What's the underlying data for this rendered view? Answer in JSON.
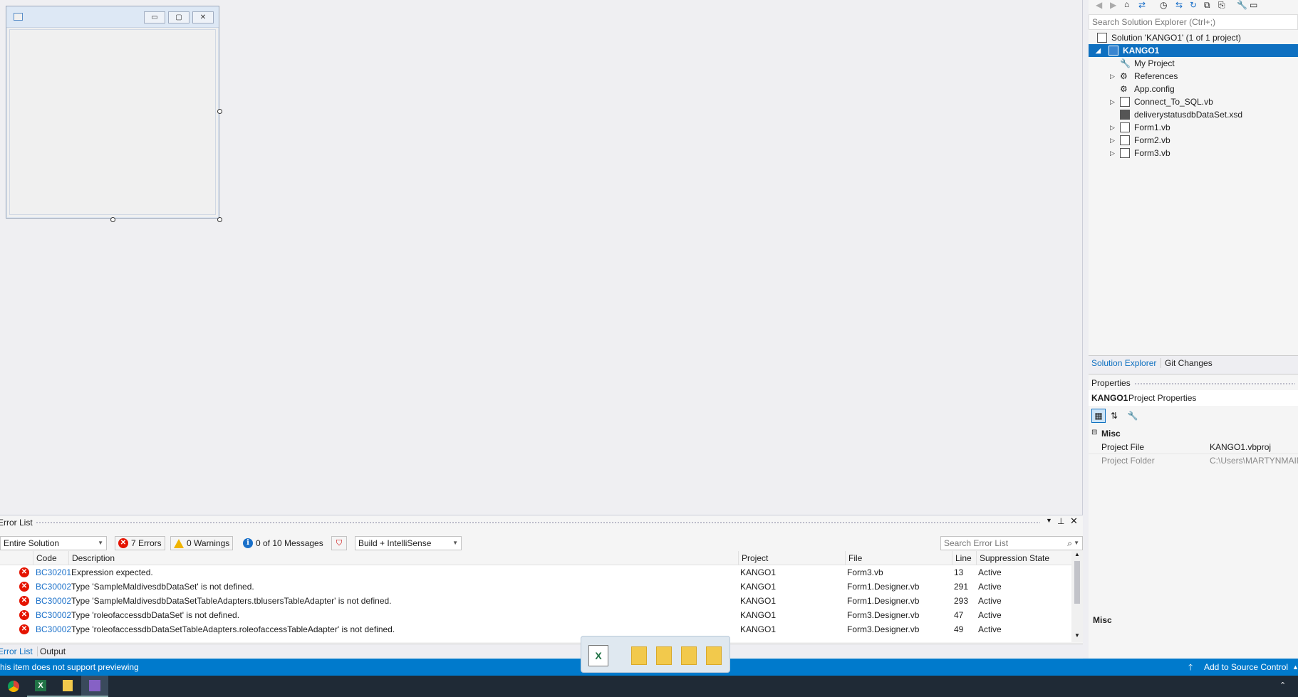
{
  "designer": {
    "form_buttons": [
      "▭",
      "▢",
      "✕"
    ]
  },
  "error_list": {
    "title": "Error List",
    "scope": "Entire Solution",
    "errors_btn": "7 Errors",
    "warnings_btn": "0 Warnings",
    "messages_btn": "0 of 10 Messages",
    "build_filter": "Build + IntelliSense",
    "search_placeholder": "Search Error List",
    "columns": [
      "Code",
      "Description",
      "Project",
      "File",
      "Line",
      "Suppression State"
    ],
    "rows": [
      {
        "code": "BC30201",
        "description": "Expression expected.",
        "project": "KANGO1",
        "file": "Form3.vb",
        "line": "13",
        "state": "Active"
      },
      {
        "code": "BC30002",
        "description": "Type 'SampleMaldivesdbDataSet' is not defined.",
        "project": "KANGO1",
        "file": "Form1.Designer.vb",
        "line": "291",
        "state": "Active"
      },
      {
        "code": "BC30002",
        "description": "Type 'SampleMaldivesdbDataSetTableAdapters.tblusersTableAdapter' is not defined.",
        "project": "KANGO1",
        "file": "Form1.Designer.vb",
        "line": "293",
        "state": "Active"
      },
      {
        "code": "BC30002",
        "description": "Type 'roleofaccessdbDataSet' is not defined.",
        "project": "KANGO1",
        "file": "Form3.Designer.vb",
        "line": "47",
        "state": "Active"
      },
      {
        "code": "BC30002",
        "description": "Type 'roleofaccessdbDataSetTableAdapters.roleofaccessTableAdapter' is not defined.",
        "project": "KANGO1",
        "file": "Form3.Designer.vb",
        "line": "49",
        "state": "Active"
      }
    ],
    "tabs": [
      "Error List",
      "Output"
    ]
  },
  "solution_explorer": {
    "search_placeholder": "Search Solution Explorer (Ctrl+;)",
    "items": [
      {
        "label": "Solution 'KANGO1' (1 of 1 project)",
        "icon": "solution-icon"
      },
      {
        "label": "KANGO1",
        "icon": "vb-project-icon"
      },
      {
        "label": "My Project",
        "icon": "wrench-icon"
      },
      {
        "label": "References",
        "icon": "references-icon"
      },
      {
        "label": "App.config",
        "icon": "config-icon"
      },
      {
        "label": "Connect_To_SQL.vb",
        "icon": "form-file-icon"
      },
      {
        "label": "deliverystatusdbDataSet.xsd",
        "icon": "dataset-icon"
      },
      {
        "label": "Form1.vb",
        "icon": "form-file-icon"
      },
      {
        "label": "Form2.vb",
        "icon": "form-file-icon"
      },
      {
        "label": "Form3.vb",
        "icon": "form-file-icon"
      }
    ],
    "tabs": [
      "Solution Explorer",
      "Git Changes"
    ]
  },
  "properties": {
    "title": "Properties",
    "object_name": "KANGO1",
    "object_type": "Project Properties",
    "category": "Misc",
    "rows": [
      {
        "name": "Project File",
        "value": "KANGO1.vbproj"
      },
      {
        "name": "Project Folder",
        "value": "C:\\Users\\MARTYNMAIN"
      }
    ],
    "description_title": "Misc"
  },
  "status_bar": {
    "left_text": "his item does not support previewing",
    "right_text": "Add to Source Control"
  },
  "colors": {
    "accent": "#007acc",
    "error": "#e51400",
    "selection": "#0e70c0"
  }
}
